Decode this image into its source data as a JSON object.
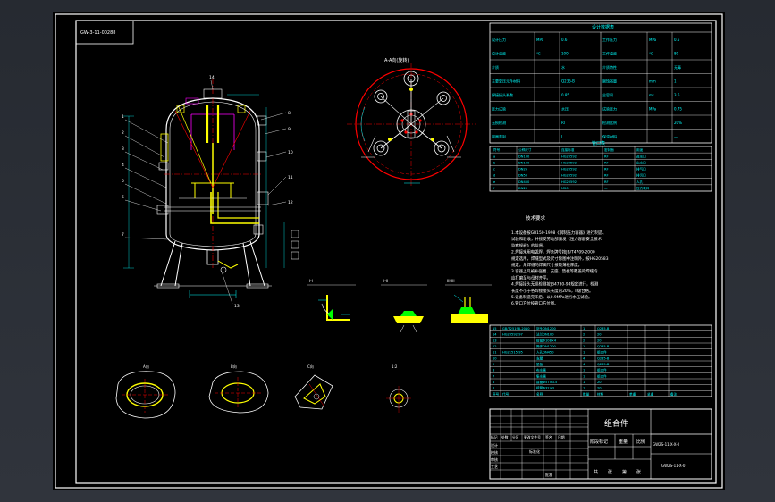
{
  "colors": {
    "background": "#000000",
    "frame": "#ffffff",
    "line_cyan": "#00ffff",
    "line_red": "#ff0000",
    "line_yellow": "#ffff00",
    "line_magenta": "#ff00ff",
    "line_green": "#00ff00",
    "table_cyan": "#00ffff"
  },
  "title_block": {
    "drawing_no_tag": "GW-3-11-00288",
    "assembly_title": "组合件",
    "header_labels": [
      "标记",
      "处数",
      "分区",
      "更改文件号",
      "签名",
      "日期"
    ],
    "stage_label": "阶段标记",
    "weight_label": "重量",
    "scale_label": "比例",
    "sheet_label": "共",
    "sheet_of": "张",
    "sheet_no_label": "第",
    "sheet_no_of": "张",
    "rows": [
      "设计",
      "校核",
      "审核",
      "工艺"
    ],
    "std_label": "标准化",
    "approve_label": "批准",
    "drawing_code": "GW2S-11-X-X-0",
    "drawing_code_right": "GW2S-11-X-0"
  },
  "views": {
    "plan_view_label": "A-A向(旋转)",
    "section_11": "1:1",
    "section_detail_1": "I-I",
    "section_detail_2": "II-II",
    "section_detail_3": "III-III",
    "detail_a": "A向",
    "detail_b": "B向",
    "detail_c": "C向",
    "detail_ratio": "1:2",
    "callouts": [
      "1",
      "2",
      "3",
      "4",
      "5",
      "6",
      "7",
      "8",
      "9",
      "10",
      "11",
      "12",
      "13",
      "14",
      "15"
    ]
  },
  "tech_requirements": {
    "title": "技术要求",
    "lines": [
      "1.本设备按GB150-1998《钢制压力容器》进行制造、",
      "  试验和验收，并接受劳动部颁发《压力容器安全技术",
      "  监察规程》的监督。",
      "2.焊接采用电弧焊，焊条牌号按JB/T4709-2000",
      "  规定选用，焊缝型式及尺寸除图中注明外，按HG20583",
      "  规定，角焊缝的焊脚尺寸按较薄板厚度。",
      "3.容器上凡被补强圈、支座、垫板等覆盖的焊缝均",
      "  应打磨至与母材齐平。",
      "4.焊接接头无损检测按JB4730-94规定进行，检测",
      "  长度不小于各焊接接头长度的20%，II级合格。",
      "5.设备制造完毕后，以0.9MPa进行水压试验。",
      "6.管口方位按管口方位图。"
    ]
  },
  "design_data": {
    "title": "设计数据表",
    "rows": [
      [
        "设计压力",
        "MPa",
        "0.6",
        "工作压力",
        "MPa",
        "0.5"
      ],
      [
        "设计温度",
        "℃",
        "100",
        "工作温度",
        "℃",
        "80"
      ],
      [
        "介质",
        "",
        "水",
        "介质特性",
        "",
        "无毒"
      ],
      [
        "主要受压元件材料",
        "",
        "Q235-B",
        "腐蚀裕量",
        "mm",
        "1"
      ],
      [
        "焊接接头系数",
        "",
        "0.85",
        "全容积",
        "m³",
        "3.6"
      ],
      [
        "压力试验",
        "",
        "水压",
        "试验压力",
        "MPa",
        "0.75"
      ],
      [
        "无损检测",
        "",
        "RT",
        "检测比例",
        "",
        "20%"
      ],
      [
        "容器类别",
        "",
        "I",
        "保温材料",
        "",
        "—"
      ]
    ]
  },
  "nozzle_table": {
    "title": "管口表",
    "headers": [
      "符号",
      "公称尺寸",
      "连接标准",
      "密封面",
      "用途"
    ],
    "rows": [
      [
        "a",
        "DN100",
        "HG20592",
        "RF",
        "进水口"
      ],
      [
        "b",
        "DN100",
        "HG20592",
        "RF",
        "出水口"
      ],
      [
        "c",
        "DN25",
        "HG20592",
        "RF",
        "排气口"
      ],
      [
        "d",
        "DN50",
        "HG20592",
        "RF",
        "排污口"
      ],
      [
        "e",
        "DN450",
        "HG20592",
        "RF",
        "人孔"
      ],
      [
        "f",
        "DN20",
        "M20",
        "—",
        "压力表口"
      ]
    ]
  },
  "parts_list": {
    "headers": [
      "序号",
      "代号",
      "名称",
      "数量",
      "材料",
      "单重",
      "总重",
      "备注"
    ],
    "rows": [
      [
        "15",
        "GB/T25198-2010",
        "封头DN1200",
        "1",
        "Q235-B",
        "",
        "",
        ""
      ],
      [
        "14",
        "HG20592-97",
        "法兰DN100",
        "2",
        "20",
        "",
        "",
        ""
      ],
      [
        "13",
        "",
        "接管Φ108×4",
        "2",
        "20",
        "",
        "",
        ""
      ],
      [
        "12",
        "",
        "筒体DN1200",
        "1",
        "Q235-B",
        "",
        "",
        ""
      ],
      [
        "11",
        "HG21515-95",
        "人孔DN450",
        "1",
        "组合件",
        "",
        "",
        ""
      ],
      [
        "10",
        "",
        "支腿",
        "4",
        "Q235-B",
        "",
        "",
        ""
      ],
      [
        "9",
        "",
        "垫板",
        "4",
        "Q235-B",
        "",
        "",
        ""
      ],
      [
        "8",
        "",
        "布水器",
        "1",
        "组合件",
        "",
        "",
        ""
      ],
      [
        "7",
        "",
        "集水器",
        "1",
        "组合件",
        "",
        "",
        ""
      ],
      [
        "6",
        "",
        "接管Φ57×3.5",
        "1",
        "20",
        "",
        "",
        ""
      ],
      [
        "5",
        "",
        "接管Φ32×3",
        "1",
        "20",
        "",
        "",
        ""
      ]
    ]
  }
}
